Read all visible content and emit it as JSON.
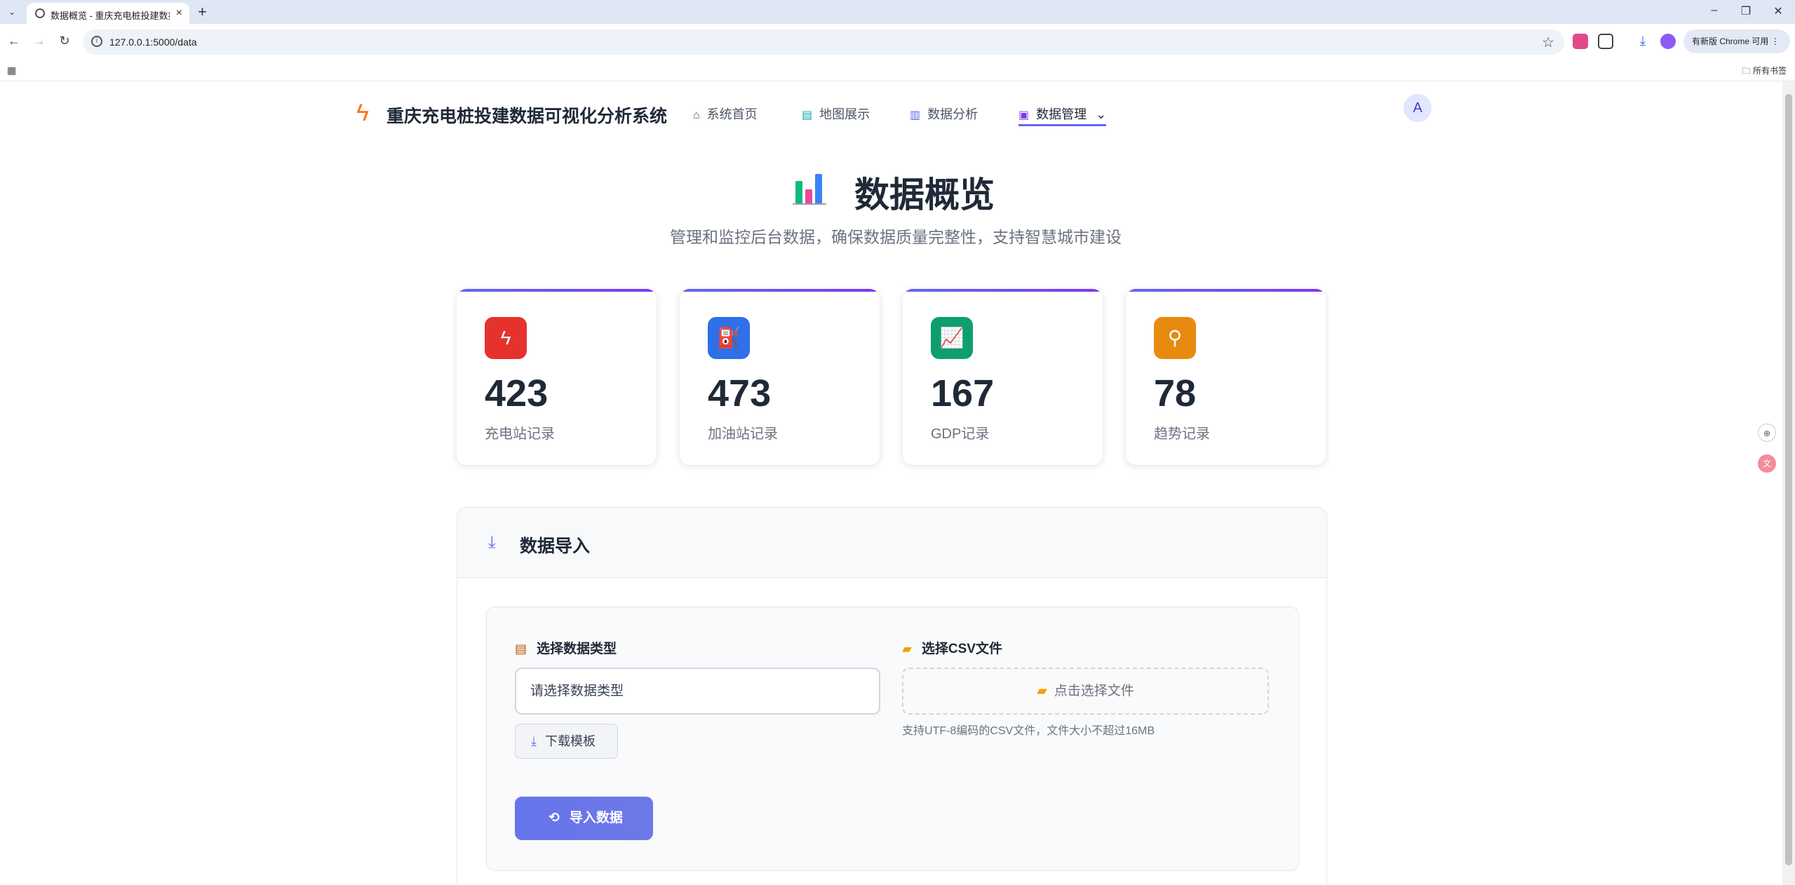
{
  "browser": {
    "tab_title": "数据概览 - 重庆充电桩投建数据可视化分析系统",
    "url": "127.0.0.1:5000/data",
    "update_label": "有新版 Chrome 可用",
    "all_bookmarks": "所有书签"
  },
  "nav": {
    "brand": "重庆充电桩投建数据可视化分析系统",
    "items": [
      {
        "label": "系统首页",
        "icon": "home-icon"
      },
      {
        "label": "地图展示",
        "icon": "map-icon"
      },
      {
        "label": "数据分析",
        "icon": "chart-icon"
      },
      {
        "label": "数据管理",
        "icon": "save-icon"
      }
    ],
    "avatar": "A"
  },
  "hero": {
    "title": "数据概览",
    "subtitle": "管理和监控后台数据，确保数据质量完整性，支持智慧城市建设"
  },
  "stats": [
    {
      "value": "423",
      "label": "充电站记录",
      "icon": "lightning-icon",
      "color": "#e5322d"
    },
    {
      "value": "473",
      "label": "加油站记录",
      "icon": "fuel-icon",
      "color": "#2f6fe8"
    },
    {
      "value": "167",
      "label": "GDP记录",
      "icon": "trend-chart-icon",
      "color": "#0f9f6e"
    },
    {
      "value": "78",
      "label": "趋势记录",
      "icon": "trend-icon",
      "color": "#e88a0f"
    }
  ],
  "import": {
    "title": "数据导入",
    "type_label": "选择数据类型",
    "type_placeholder": "请选择数据类型",
    "template_button": "下载模板",
    "file_label": "选择CSV文件",
    "file_button": "点击选择文件",
    "file_hint": "支持UTF-8编码的CSV文件，文件大小不超过16MB",
    "import_button": "导入数据"
  },
  "colors": {
    "accent": "#6366f1",
    "brand_orange": "#f97316"
  }
}
